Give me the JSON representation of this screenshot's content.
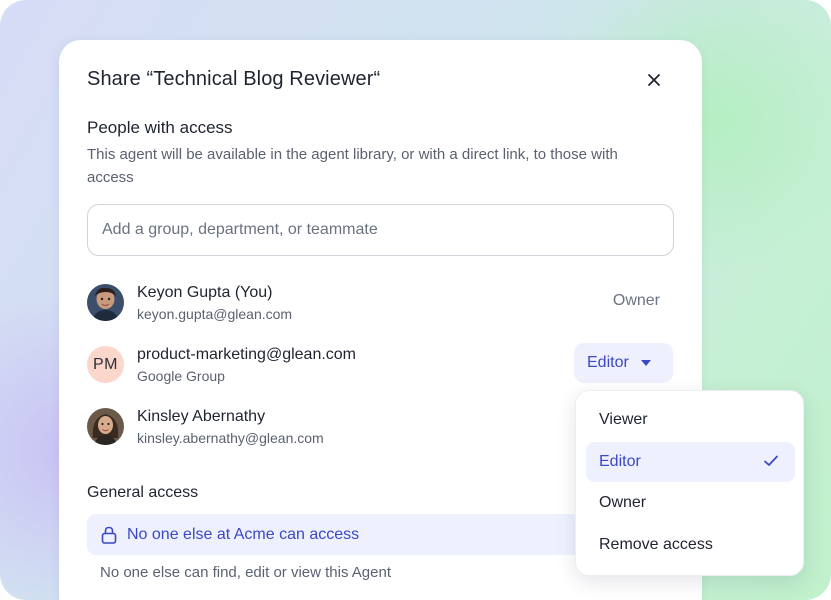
{
  "dialog": {
    "title": "Share “Technical Blog Reviewer“",
    "close_icon": "close-icon"
  },
  "people_access": {
    "heading": "People with access",
    "description": "This agent will be available in the agent library, or with a direct link, to those with access",
    "search_placeholder": "Add a group, department, or teammate",
    "search_value": ""
  },
  "people": [
    {
      "name": "Keyon Gupta (You)",
      "sub": "keyon.gupta@glean.com",
      "role": "Owner",
      "avatar": "photo"
    },
    {
      "name": "product-marketing@glean.com",
      "sub": "Google Group",
      "role": "Editor",
      "initials": "PM"
    },
    {
      "name": "Kinsley Abernathy",
      "sub": "kinsley.abernathy@glean.com",
      "avatar": "photo"
    }
  ],
  "general_access": {
    "heading": "General access",
    "banner_label": "No one else at Acme can access",
    "banner_icon": "lock-icon",
    "note": "No one else can find, edit or view this Agent"
  },
  "role_menu": {
    "items": [
      {
        "label": "Viewer",
        "selected": false
      },
      {
        "label": "Editor",
        "selected": true
      },
      {
        "label": "Owner",
        "selected": false
      },
      {
        "label": "Remove access",
        "selected": false
      }
    ],
    "check_icon": "check-icon"
  },
  "colors": {
    "accent": "#3b48c4",
    "accent_bg": "#eef1fd",
    "initials_bg": "#fbd6cb"
  }
}
